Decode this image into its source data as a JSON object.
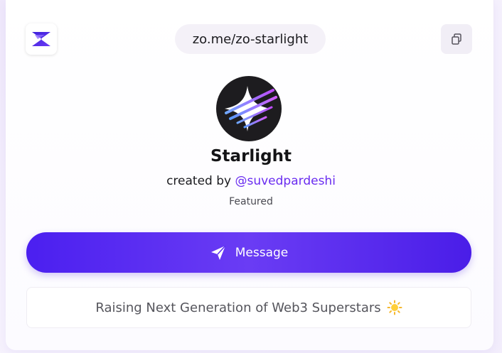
{
  "header": {
    "url": "zo.me/zo-starlight"
  },
  "profile": {
    "name": "Starlight",
    "created_by_prefix": "created by",
    "creator_handle": "@suvedpardeshi",
    "badge": "Featured"
  },
  "actions": {
    "message_label": "Message"
  },
  "bio": {
    "text": "Raising Next Generation of Web3 Superstars"
  },
  "icons": {
    "logo": "zo-logo-icon",
    "copy": "copy-icon",
    "send": "send-icon",
    "sun": "sun-icon"
  },
  "colors": {
    "accent": "#5a2df2",
    "handle": "#6a2cf0",
    "avatar_bg": "#1d1c1f"
  }
}
